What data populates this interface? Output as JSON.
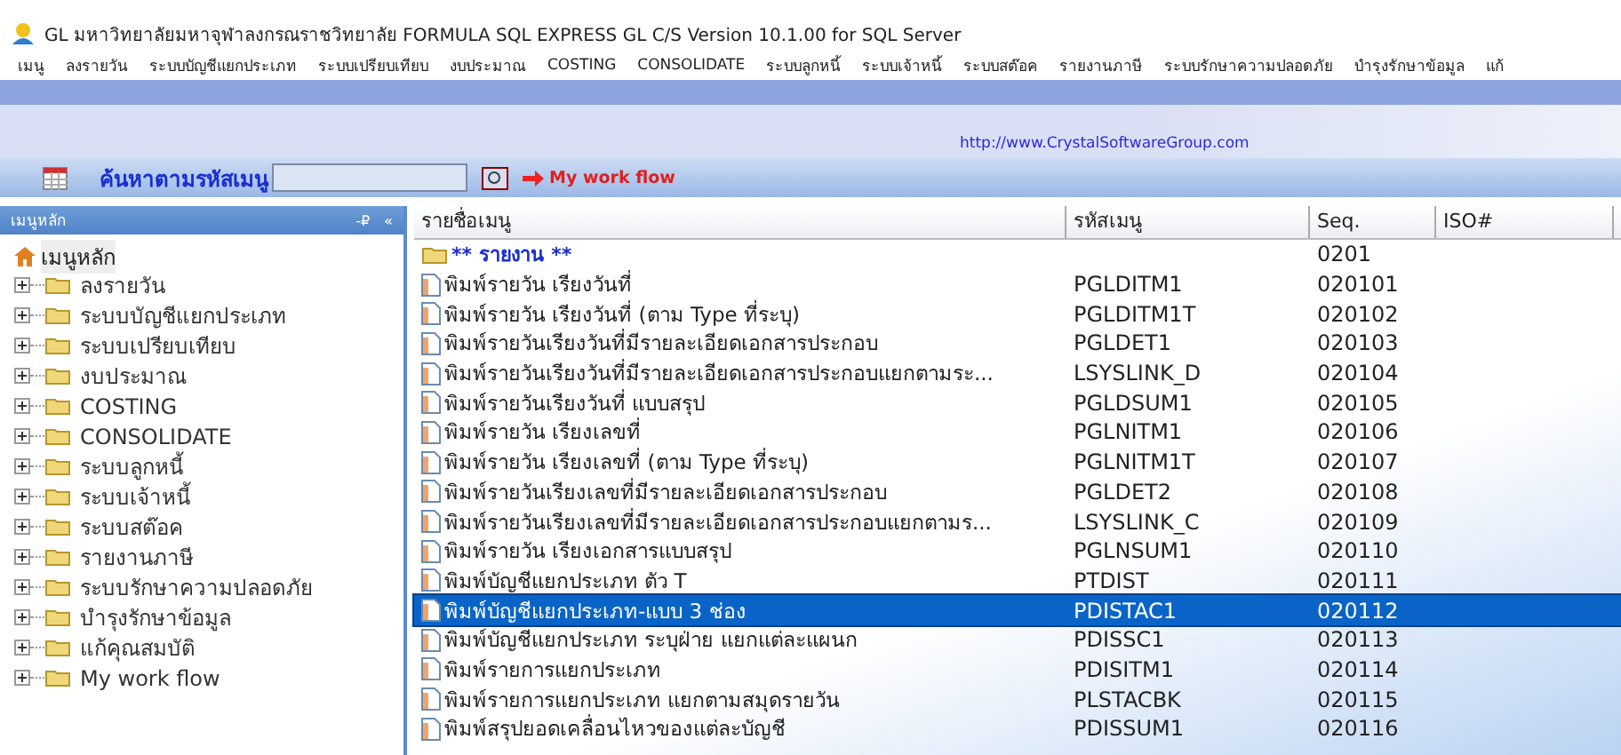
{
  "window": {
    "title": "GL มหาวิทยาลัยมหาจุฬาลงกรณราชวิทยาลัย FORMULA SQL EXPRESS GL C/S Version 10.1.00 for SQL Server"
  },
  "menu": [
    "เมนู",
    "ลงรายวัน",
    "ระบบบัญชีแยกประเภท",
    "ระบบเปรียบเทียบ",
    "งบประมาณ",
    "COSTING",
    "CONSOLIDATE",
    "ระบบลูกหนี้",
    "ระบบเจ้าหนี้",
    "ระบบสต๊อค",
    "รายงานภาษี",
    "ระบบรักษาความปลอดภัย",
    "บำรุงรักษาข้อมูล",
    "แก้"
  ],
  "banner": {
    "link": "http://www.CrystalSoftwareGroup.com"
  },
  "toolbar": {
    "search_label": "ค้นหาตามรหัสเมนู",
    "workflow": "My work flow"
  },
  "sidebar": {
    "title": "เมนูหลัก",
    "pin": "-₽",
    "collapse": "«",
    "root": {
      "label": "เมนูหลัก",
      "selected": true
    },
    "items": [
      {
        "label": "ลงรายวัน",
        "expanded": false
      },
      {
        "label": "ระบบบัญชีแยกประเภท",
        "expanded": false
      },
      {
        "label": "ระบบเปรียบเทียบ",
        "expanded": false
      },
      {
        "label": "งบประมาณ",
        "expanded": false
      },
      {
        "label": "COSTING",
        "expanded": false
      },
      {
        "label": "CONSOLIDATE",
        "expanded": false
      },
      {
        "label": "ระบบลูกหนี้",
        "expanded": false
      },
      {
        "label": "ระบบเจ้าหนี้",
        "expanded": false
      },
      {
        "label": "ระบบสต๊อค",
        "expanded": false
      },
      {
        "label": "รายงานภาษี",
        "expanded": false
      },
      {
        "label": "ระบบรักษาความปลอดภัย",
        "expanded": false
      },
      {
        "label": "บำรุงรักษาข้อมูล",
        "expanded": false
      },
      {
        "label": "แก้คุณสมบัติ",
        "expanded": false
      },
      {
        "label": "My work flow",
        "expanded": false
      }
    ]
  },
  "table": {
    "columns": [
      "รายชื่อเมนู",
      "รหัสเมนู",
      "Seq.",
      "ISO#"
    ],
    "rows": [
      {
        "kind": "folder",
        "name": "** รายงาน **",
        "seq": "0201",
        "selected": false
      },
      {
        "kind": "report",
        "name": "พิมพ์รายวัน เรียงวันที่",
        "code": "PGLDITM1",
        "seq": "020101",
        "selected": false
      },
      {
        "kind": "report",
        "name": "พิมพ์รายวัน เรียงวันที่ (ตาม Type ที่ระบุ)",
        "code": "PGLDITM1T",
        "seq": "020102",
        "selected": false
      },
      {
        "kind": "report",
        "name": "พิมพ์รายวันเรียงวันที่มีรายละเอียดเอกสารประกอบ",
        "code": "PGLDET1",
        "seq": "020103",
        "selected": false
      },
      {
        "kind": "report",
        "name": "พิมพ์รายวันเรียงวันที่มีรายละเอียดเอกสารประกอบแยกตามระ...",
        "code": "LSYSLINK_D",
        "seq": "020104",
        "selected": false
      },
      {
        "kind": "report",
        "name": "พิมพ์รายวันเรียงวันที่ แบบสรุป",
        "code": "PGLDSUM1",
        "seq": "020105",
        "selected": false
      },
      {
        "kind": "report",
        "name": "พิมพ์รายวัน เรียงเลขที่",
        "code": "PGLNITM1",
        "seq": "020106",
        "selected": false
      },
      {
        "kind": "report",
        "name": "พิมพ์รายวัน เรียงเลขที่ (ตาม Type ที่ระบุ)",
        "code": "PGLNITM1T",
        "seq": "020107",
        "selected": false
      },
      {
        "kind": "report",
        "name": "พิมพ์รายวันเรียงเลขที่มีรายละเอียดเอกสารประกอบ",
        "code": "PGLDET2",
        "seq": "020108",
        "selected": false
      },
      {
        "kind": "report",
        "name": "พิมพ์รายวันเรียงเลขที่มีรายละเอียดเอกสารประกอบแยกตามร...",
        "code": "LSYSLINK_C",
        "seq": "020109",
        "selected": false
      },
      {
        "kind": "report",
        "name": "พิมพ์รายวัน เรียงเอกสารแบบสรุป",
        "code": "PGLNSUM1",
        "seq": "020110",
        "selected": false
      },
      {
        "kind": "report",
        "name": "พิมพ์บัญชีแยกประเภท ตัว T",
        "code": "PTDIST",
        "seq": "020111",
        "selected": false
      },
      {
        "kind": "report",
        "name": "พิมพ์บัญชีแยกประเภท-แบบ 3 ช่อง",
        "code": "PDISTAC1",
        "seq": "020112",
        "selected": true
      },
      {
        "kind": "report",
        "name": "พิมพ์บัญชีแยกประเภท ระบุฝ่าย แยกแต่ละแผนก",
        "code": "PDISSC1",
        "seq": "020113",
        "selected": false
      },
      {
        "kind": "report",
        "name": "พิมพ์รายการแยกประเภท",
        "code": "PDISITM1",
        "seq": "020114",
        "selected": false
      },
      {
        "kind": "report",
        "name": "พิมพ์รายการแยกประเภท แยกตามสมุดรายวัน",
        "code": "PLSTACBK",
        "seq": "020115",
        "selected": false
      },
      {
        "kind": "report",
        "name": "พิมพ์สรุปยอดเคลื่อนไหวของแต่ละบัญชี",
        "code": "PDISSUM1",
        "seq": "020116",
        "selected": false
      }
    ]
  }
}
